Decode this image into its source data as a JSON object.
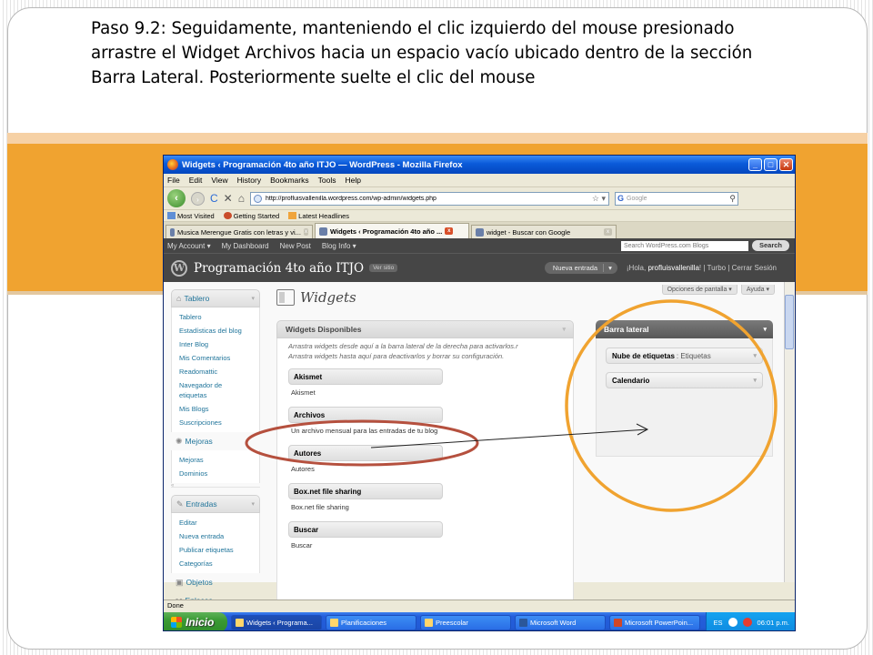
{
  "caption": "Paso 9.2: Seguidamente, manteniendo el clic izquierdo del mouse presionado arrastre el Widget Archivos hacia un espacio vacío ubicado dentro de la sección Barra  Lateral. Posteriormente suelte el clic del mouse",
  "browser": {
    "title": "Widgets ‹ Programación 4to año ITJO — WordPress - Mozilla Firefox",
    "menu": [
      "File",
      "Edit",
      "View",
      "History",
      "Bookmarks",
      "Tools",
      "Help"
    ],
    "url": "http://profluisvallenilla.wordpress.com/wp-admin/widgets.php",
    "search_engine": "Google",
    "bookmarks": [
      "Most Visited",
      "Getting Started",
      "Latest Headlines"
    ],
    "tabs": [
      {
        "label": "Musica Merengue Gratis con letras y vi..."
      },
      {
        "label": "Widgets ‹ Programación 4to año ..."
      },
      {
        "label": "widget - Buscar con Google"
      }
    ],
    "status": "Done"
  },
  "wp": {
    "admin_bar": [
      "My Account ▾",
      "My Dashboard",
      "New Post",
      "Blog Info ▾"
    ],
    "search_placeholder": "Search WordPress.com Blogs",
    "search_button": "Search",
    "site_name": "Programación 4to año ITJO",
    "ver_sitio": "Ver sitio",
    "nueva_entrada": "Nueva entrada",
    "greeting": "¡Hola, ",
    "user": "profluisvallenilla",
    "greeting_end": "! | Turbo | Cerrar Sesión",
    "screen_options": "Opciones de pantalla ▾",
    "help": "Ayuda ▾",
    "page_title": "Widgets",
    "sidebar": {
      "tablero": {
        "label": "Tablero",
        "items": [
          "Tablero",
          "Estadísticas del blog",
          "Inter Blog",
          "Mis Comentarios",
          "Readomattic",
          "Navegador de etiquetas",
          "Mis Blogs",
          "Suscripciones"
        ]
      },
      "mejoras": {
        "label": "Mejoras",
        "items": [
          "Mejoras",
          "Dominios"
        ]
      },
      "entradas": {
        "label": "Entradas",
        "items": [
          "Editar",
          "Nueva entrada",
          "Publicar etiquetas",
          "Categorías"
        ]
      },
      "objetos": {
        "label": "Objetos"
      },
      "enlaces": {
        "label": "Enlaces"
      }
    },
    "available": {
      "title": "Widgets Disponibles",
      "description": "Arrastra widgets desde aquí a la barra lateral de la derecha para activarlos.r Arrastra widgets hasta aquí para deactivarlos y borrar su configuración.",
      "widgets": [
        {
          "name": "Akismet",
          "desc": "Akismet"
        },
        {
          "name": "Archivos",
          "desc": "Un archivo mensual para las entradas de tu blog"
        },
        {
          "name": "Autores",
          "desc": "Autores"
        },
        {
          "name": "Box.net file sharing",
          "desc": "Box.net file sharing"
        },
        {
          "name": "Buscar",
          "desc": "Buscar"
        }
      ]
    },
    "barra_lateral": {
      "title": "Barra lateral",
      "widgets": [
        {
          "name": "Nube de etiquetas",
          "sub": ": Etiquetas"
        },
        {
          "name": "Calendario",
          "sub": ""
        }
      ]
    }
  },
  "taskbar": {
    "start": "Inicio",
    "items": [
      "Widgets ‹ Programa...",
      "Planificaciones",
      "Preescolar",
      "Microsoft Word",
      "Microsoft PowerPoin..."
    ],
    "lang": "ES",
    "clock": "06:01 p.m."
  },
  "colors": {
    "band": "#f0a330",
    "ellipse": "#b5503e",
    "circle": "#f0a330",
    "wp_link": "#21759b"
  }
}
